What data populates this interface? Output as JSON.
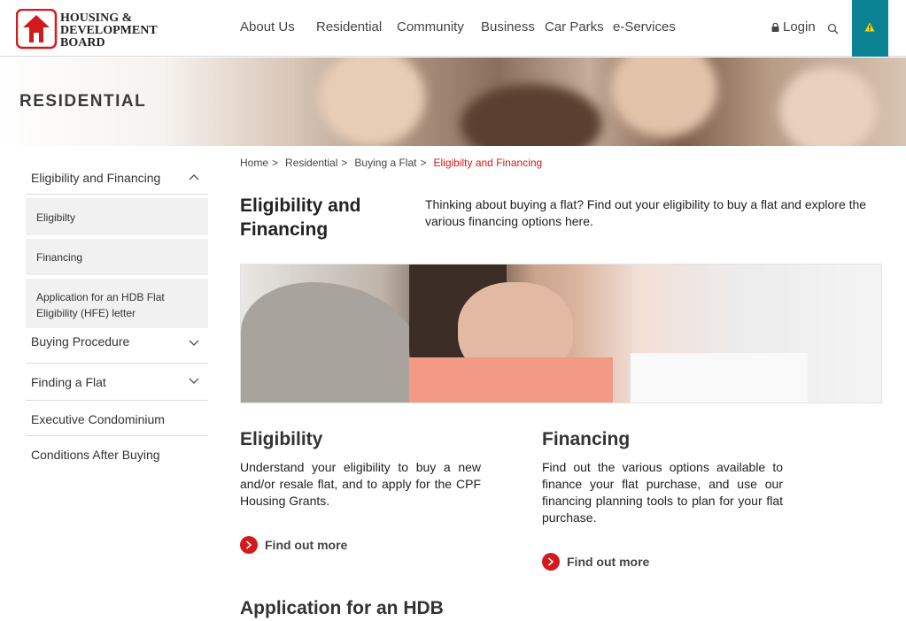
{
  "header": {
    "logo_text": [
      "HOUSING &",
      "DEVELOPMENT",
      "BOARD"
    ],
    "nav": [
      "About Us",
      "Residential",
      "Community",
      "Business",
      "Car Parks",
      "e-Services"
    ],
    "login_label": "Login",
    "icons": {
      "lock": "lock-icon",
      "search": "search-icon",
      "alert": "warning-icon"
    },
    "colors": {
      "brand_red": "#d31a1a",
      "alert_bg": "#0a8291"
    }
  },
  "hero": {
    "title": "RESIDENTIAL"
  },
  "sidebar": {
    "section": "Eligibility and Financing",
    "sub_items": [
      "Eligibilty",
      "Financing",
      "Application for an HDB Flat Eligibility (HFE) letter"
    ],
    "collapsed_sections": [
      "Buying Procedure",
      "Finding a Flat"
    ],
    "links": [
      "Executive Condominium",
      "Conditions After Buying"
    ]
  },
  "breadcrumb": {
    "items": [
      "Home",
      "Residential",
      "Buying a Flat"
    ],
    "separator": ">",
    "current": "Eligibilty and Financing"
  },
  "main": {
    "title": "Eligibility and Financing",
    "intro": "Thinking about buying a flat? Find out your eligibility to buy a flat and explore the various financing options here.",
    "cards": [
      {
        "title": "Eligibility",
        "text": "Understand your eligibility to buy a new and/or resale flat, and to apply for the CPF Housing Grants.",
        "link": "Find out more"
      },
      {
        "title": "Financing",
        "text": "Find out the various options available to finance your flat purchase, and use our financing planning tools to plan for your flat purchase.",
        "link": "Find out more"
      }
    ],
    "next_section_title": "Application for an HDB"
  }
}
